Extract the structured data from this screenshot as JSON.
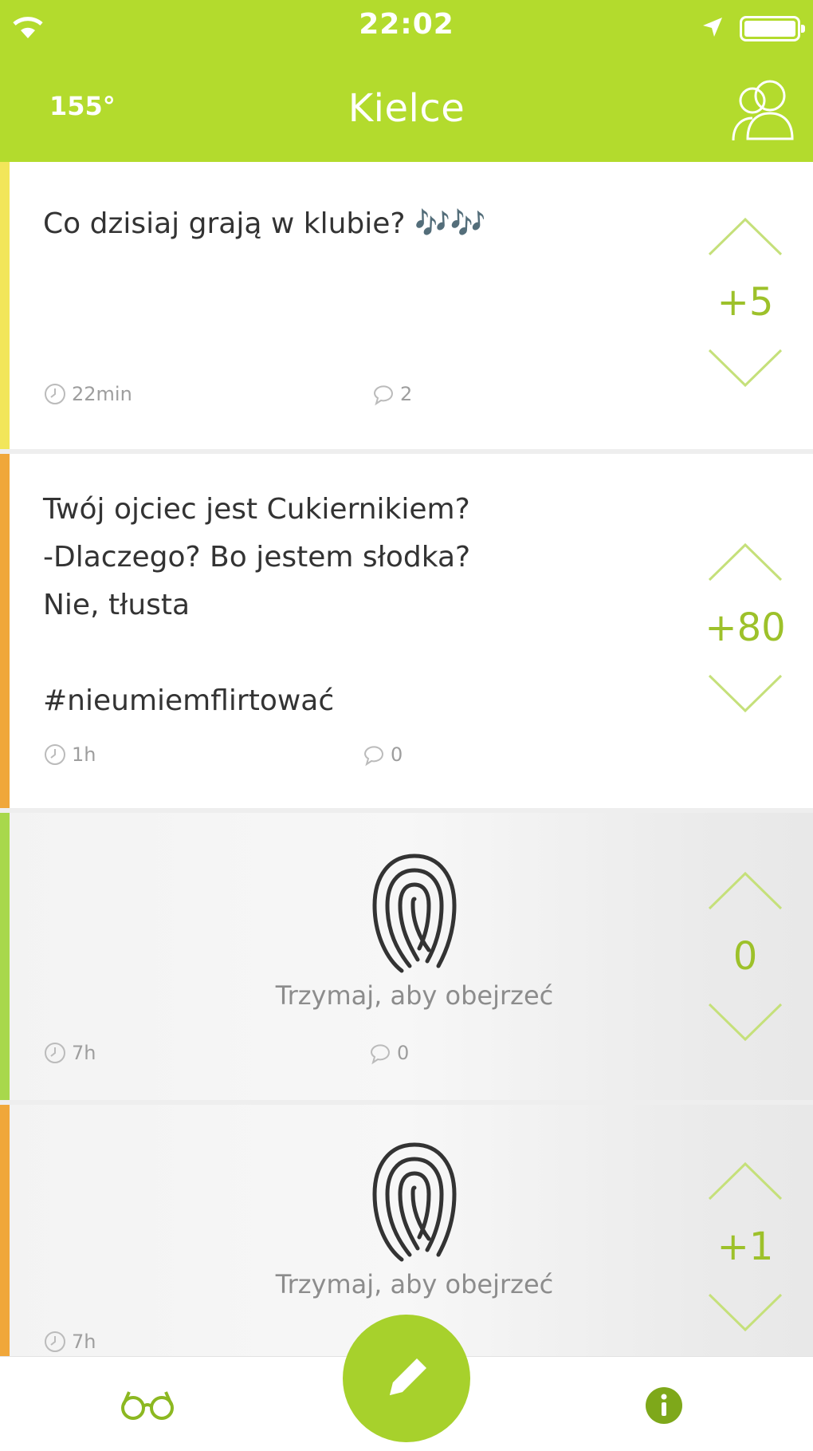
{
  "status_bar": {
    "time": "22:02"
  },
  "header": {
    "karma": "155°",
    "city": "Kielce"
  },
  "posts": [
    {
      "text": "Co dzisiaj grają w klubie? 🎶🎶",
      "time": "22min",
      "comments": "2",
      "votes": "+5",
      "stripe_color": "#f2e65a"
    },
    {
      "text": "Twój ojciec jest Cukiernikiem?\n-Dlaczego? Bo jestem słodka?\nNie, tłusta\n\n#nieumiemflirtować",
      "time": "1h",
      "comments": "0",
      "votes": "+80",
      "stripe_color": "#f0a73a"
    },
    {
      "hint": "Trzymaj, aby obejrzeć",
      "time": "7h",
      "comments": "0",
      "votes": "0",
      "stripe_color": "#a8d84c"
    },
    {
      "hint": "Trzymaj, aby obejrzeć",
      "time": "7h",
      "votes": "+1",
      "stripe_color": "#f0a73a"
    }
  ],
  "colors": {
    "accent": "#b3db2d",
    "vote": "#9dc12a"
  },
  "icons": {
    "people": "people-icon",
    "glasses": "glasses-icon",
    "info": "info-icon",
    "compose": "pencil-icon",
    "fingerprint": "fingerprint-icon"
  }
}
